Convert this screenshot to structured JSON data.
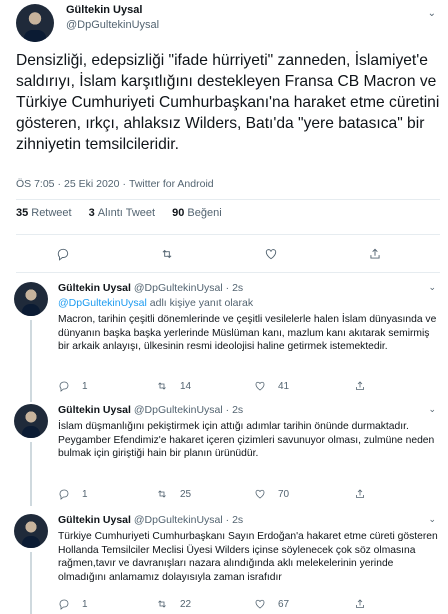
{
  "main_tweet": {
    "author_name": "Gültekin Uysal",
    "author_handle": "@DpGultekinUysal",
    "text": "Densizliği, edepsizliği \"ifade hürriyeti\" zanneden, İslamiyet'e saldırıyı, İslam karşıtlığını destekleyen Fransa CB Macron ve Türkiye Cumhuriyeti Cumhurbaşkanı'na haraket etme cüretini gösteren, ırkçı, ahlaksız Wilders, Batı'da \"yere batasıca\" bir zihniyetin temsilcileridir.",
    "time": "ÖS 7:05",
    "date": "25 Eki 2020",
    "client": "Twitter for Android",
    "retweets_count": "35",
    "retweets_label": "Retweet",
    "quotes_count": "3",
    "quotes_label": "Alıntı Tweet",
    "likes_count": "90",
    "likes_label": "Beğeni"
  },
  "replies": [
    {
      "author_name": "Gültekin Uysal",
      "author_handle": "@DpGultekinUysal",
      "time": "2s",
      "reply_to_handle": "@DpGultekinUysal",
      "reply_to_suffix": "adlı kişiye yanıt olarak",
      "text": "Macron, tarihin çeşitli dönemlerinde ve çeşitli vesilelerle halen İslam dünyasında ve dünyanın başka başka yerlerinde Müslüman kanı, mazlum kanı akıtarak semirmiş bir arkaik anlayışı, ülkesinin resmi ideolojisi haline getirmek istemektedir.",
      "replies_count": "1",
      "retweets_count": "14",
      "likes_count": "41"
    },
    {
      "author_name": "Gültekin Uysal",
      "author_handle": "@DpGultekinUysal",
      "time": "2s",
      "text": "İslam düşmanlığını pekiştirmek için attığı adımlar tarihin önünde durmaktadır.\nPeygamber Efendimiz'e hakaret içeren çizimleri savunuyor olması, zulmüne neden bulmak için giriştiği hain bir planın ürünüdür.",
      "replies_count": "1",
      "retweets_count": "25",
      "likes_count": "70"
    },
    {
      "author_name": "Gültekin Uysal",
      "author_handle": "@DpGultekinUysal",
      "time": "2s",
      "text": "Türkiye Cumhuriyeti Cumhurbaşkanı Sayın Erdoğan'a hakaret etme cüreti gösteren Hollanda Temsilciler Meclisi Üyesi Wilders içinse söylenecek çok söz olmasına rağmen,tavır ve davranışları nazara alındığında aklı melekelerinin yerinde olmadığını anlamamız dolayısıyla zaman israfıdır",
      "replies_count": "1",
      "retweets_count": "22",
      "likes_count": "67"
    }
  ]
}
